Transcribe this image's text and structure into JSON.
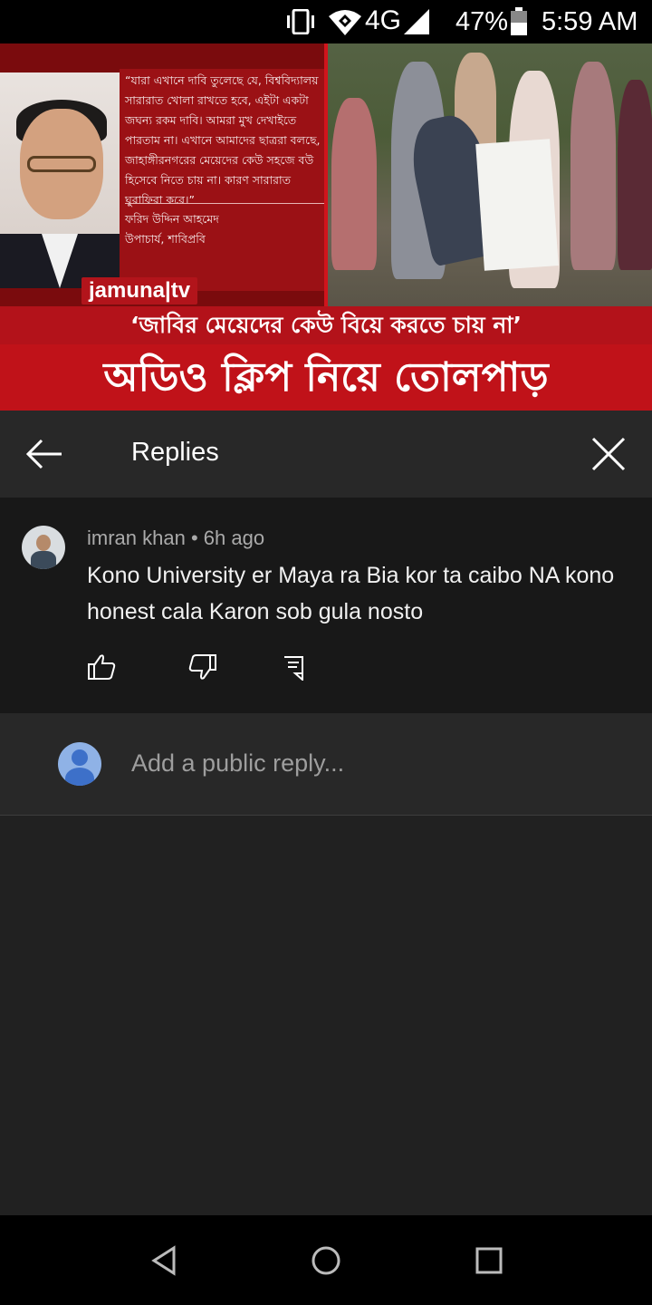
{
  "status_bar": {
    "network": "4G",
    "battery_percent": "47%",
    "time": "5:59 AM"
  },
  "video": {
    "quote": "“যারা এখানে দাবি তুলেছে যে, বিশ্ববিদ্যালয় সারারাত খোলা রাখতে হবে, এইটা একটা জঘন্য রকম দাবি। আমরা মুখ দেখাইতে পারতাম না। এখানে আমাদের ছাত্ররা বলছে, জাহাঙ্গীরনগরের মেয়েদের কেউ সহজে বউ হিসেবে নিতে চায় না। কারণ সারারাত ঘুরাফিরা করে।”",
    "attribution_name": "ফরিদ উদ্দিন আহমেদ",
    "attribution_role": "উপাচার্য, শাবিপ্রবি",
    "logo": "jamuna|tv",
    "banner_top": "‘জাবির মেয়েদের কেউ বিয়ে করতে চায় না’",
    "banner_bottom": "অডিও ক্লিপ নিয়ে তোলপাড়"
  },
  "header": {
    "title": "Replies"
  },
  "comment": {
    "author": "imran khan",
    "separator": " • ",
    "time": "6h ago",
    "text": "Kono University er Maya ra Bia kor ta caibo NA kono honest cala Karon sob gula nosto"
  },
  "reply_input": {
    "placeholder": "Add a public reply..."
  },
  "icons": [
    "vibrate-icon",
    "wifi-icon",
    "signal-icon",
    "battery-icon",
    "back-arrow-icon",
    "close-icon",
    "like-icon",
    "dislike-icon",
    "reply-icon",
    "back-nav-icon",
    "home-nav-icon",
    "recents-nav-icon"
  ]
}
